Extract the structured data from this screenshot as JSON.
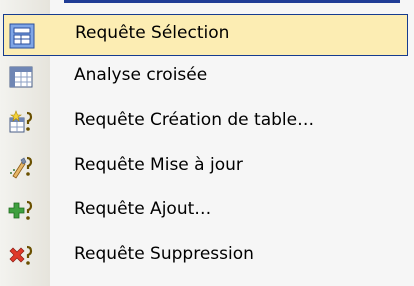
{
  "menu": {
    "items": [
      {
        "label": "Requête Sélection",
        "icon": "select-query-icon",
        "selected": true
      },
      {
        "label": "Analyse croisée",
        "icon": "crosstab-query-icon",
        "selected": false
      },
      {
        "label": "Requête Création de table…",
        "icon": "make-table-query-icon",
        "selected": false
      },
      {
        "label": "Requête Mise à jour",
        "icon": "update-query-icon",
        "selected": false
      },
      {
        "label": "Requête Ajout…",
        "icon": "append-query-icon",
        "selected": false
      },
      {
        "label": "Requête Suppression",
        "icon": "delete-query-icon",
        "selected": false
      }
    ]
  },
  "colors": {
    "highlight": "#fcedb3",
    "highlight_border": "#163c8f",
    "gutter": "#e6e4dc"
  }
}
